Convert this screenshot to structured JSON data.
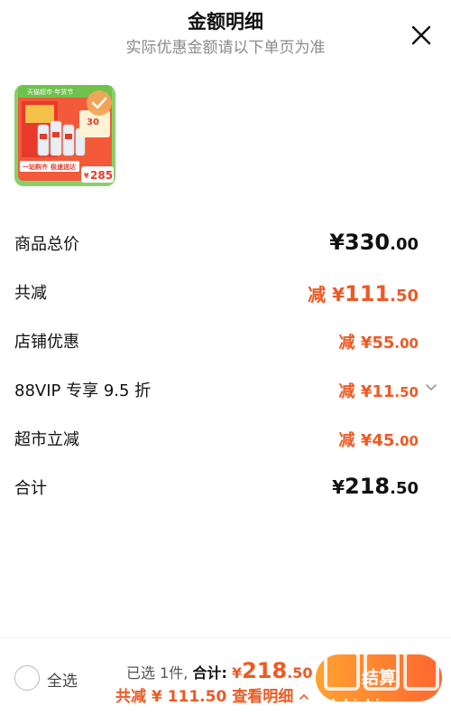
{
  "header": {
    "title": "金额明细",
    "subtitle": "实际优惠金额请以下单页为准"
  },
  "product": {
    "badge_text": "天猫超市·年货节",
    "promo_30": "30",
    "slogan_1": "一站购齐",
    "slogan_2": "极速送达",
    "price": "285",
    "price_symbol": "¥"
  },
  "rows": [
    {
      "label": "商品总价",
      "prefix": "",
      "symbol": "¥",
      "int": "330",
      "dec": ".00"
    },
    {
      "label": "共减",
      "prefix": "减 ",
      "symbol": "¥",
      "int": "111",
      "dec": ".50"
    },
    {
      "label": "店铺优惠",
      "prefix": "减 ",
      "symbol": "¥",
      "int": "55",
      "dec": ".00"
    },
    {
      "label": "88VIP 专享 9.5 折",
      "prefix": "减 ",
      "symbol": "¥",
      "int": "11",
      "dec": ".50"
    },
    {
      "label": "超市立减",
      "prefix": "减 ",
      "symbol": "¥",
      "int": "45",
      "dec": ".00"
    },
    {
      "label": "合计",
      "prefix": "",
      "symbol": "¥",
      "int": "218",
      "dec": ".50"
    }
  ],
  "footer": {
    "select_all": "全选",
    "selected_count": "已选 1件,",
    "total_label": "合计:",
    "total_symbol": "¥",
    "total_int": "218",
    "total_dec": ".50",
    "discount_text": "共减 ¥ 111.50",
    "view_detail": "查看明细",
    "checkout_label": "结算",
    "watermark": "zhizhizhi.com"
  },
  "colors": {
    "accent_orange": "#ee5a24",
    "checkout_gradient_start": "#ff9a1f",
    "checkout_gradient_end": "#ff5a1f",
    "subtitle_gray": "#8a8a8a"
  }
}
